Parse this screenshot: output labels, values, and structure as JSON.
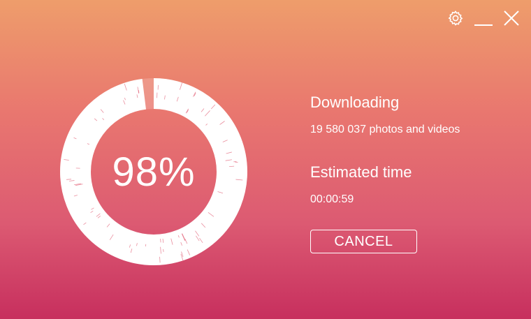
{
  "window": {
    "controls": {
      "settings_icon": "gear-icon",
      "minimize_icon": "minimize-icon",
      "close_icon": "close-icon"
    }
  },
  "progress": {
    "percent_text": "98%",
    "fraction": 0.98
  },
  "status": {
    "title": "Downloading",
    "count_text": "19 580 037 photos and videos",
    "time_label": "Estimated time",
    "time_value": "00:00:59"
  },
  "actions": {
    "cancel_label": "CANCEL"
  },
  "colors": {
    "gradient_top": "#ee9d6b",
    "gradient_bottom": "#c72f5e",
    "foreground": "#ffffff",
    "accent_streak": "#d8324f"
  }
}
